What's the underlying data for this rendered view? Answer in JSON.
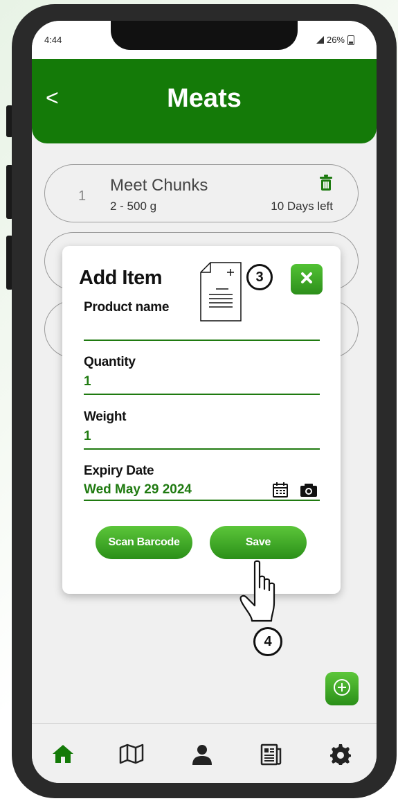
{
  "status_bar": {
    "time": "4:44",
    "battery": "26%"
  },
  "header": {
    "back_label": "<",
    "title": "Meats"
  },
  "list": [
    {
      "index": "1",
      "name": "Meet Chunks",
      "quantity": "2 - 500 g",
      "days_left": "10 Days left"
    }
  ],
  "dialog": {
    "title": "Add Item",
    "fields": {
      "product_name": {
        "label": "Product name",
        "value": ""
      },
      "quantity": {
        "label": "Quantity",
        "value": "1"
      },
      "weight": {
        "label": "Weight",
        "value": "1"
      },
      "expiry_date": {
        "label": "Expiry Date",
        "value": "Wed May 29 2024"
      }
    },
    "scan_button": "Scan Barcode",
    "save_button": "Save"
  },
  "annotations": {
    "step_3": "3",
    "step_4": "4"
  },
  "icons": [
    "trash-icon",
    "close-icon",
    "document-add-icon",
    "calendar-icon",
    "camera-icon",
    "hand-pointer-icon",
    "plus-circle-icon",
    "home-icon",
    "map-icon",
    "user-icon",
    "news-icon",
    "settings-icon"
  ],
  "colors": {
    "primary": "#147a08",
    "accent": "#4cb82e",
    "field_text": "#1f7a10"
  }
}
